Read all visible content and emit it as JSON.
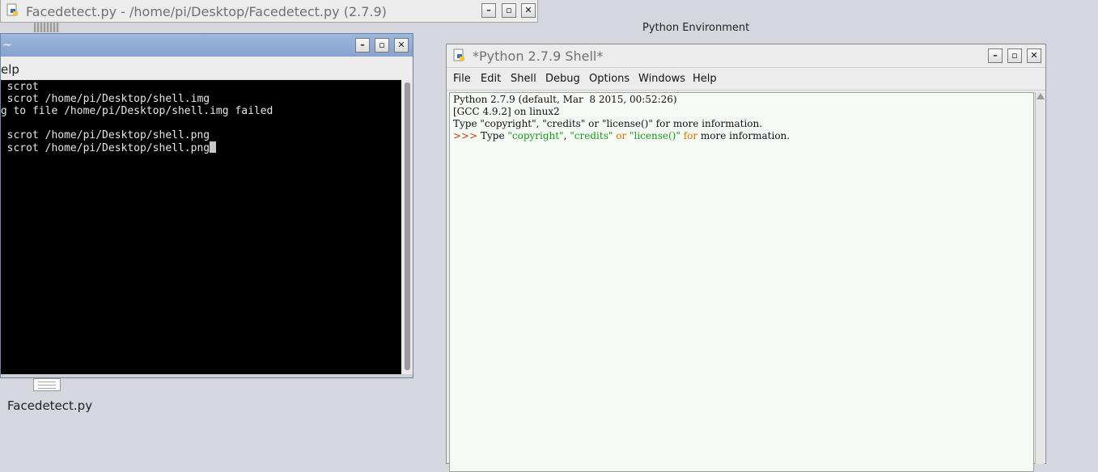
{
  "facedetect_window": {
    "title": "Facedetect.py - /home/pi/Desktop/Facedetect.py (2.7.9)",
    "minimize": "–",
    "maximize": "▫",
    "close": "✕"
  },
  "terminal_window": {
    "title": "~",
    "menu_help": "elp",
    "lines": [
      "  scrot",
      "  scrot /home/pi/Desktop/shell.img",
      "ng to file /home/pi/Desktop/shell.img failed",
      "",
      "  scrot /home/pi/Desktop/shell.png",
      "  scrot /home/pi/Desktop/shell.png"
    ],
    "minimize": "–",
    "maximize": "▫",
    "close": "✕"
  },
  "desktop": {
    "file_label": "Facedetect.py",
    "python_env_label": "Python Environment"
  },
  "shell_window": {
    "title": "*Python 2.7.9 Shell*",
    "minimize": "–",
    "maximize": "▫",
    "close": "✕",
    "menu": [
      "File",
      "Edit",
      "Shell",
      "Debug",
      "Options",
      "Windows",
      "Help"
    ],
    "output_lines": [
      "Python 2.7.9 (default, Mar  8 2015, 00:52:26)",
      "[GCC 4.9.2] on linux2",
      "Type \"copyright\", \"credits\" or \"license()\" for more information."
    ],
    "prompt": ">>>",
    "input_parts": {
      "t1": " Type ",
      "s1": "\"copyright\"",
      "t2": ", ",
      "s2": "\"credits\"",
      "k1": " or ",
      "s3": "\"license()\"",
      "k2": " for",
      "t3": " more information."
    },
    "colors": {
      "prompt": "#c04000",
      "string": "#1a9a1a",
      "keyword": "#e07000"
    }
  }
}
